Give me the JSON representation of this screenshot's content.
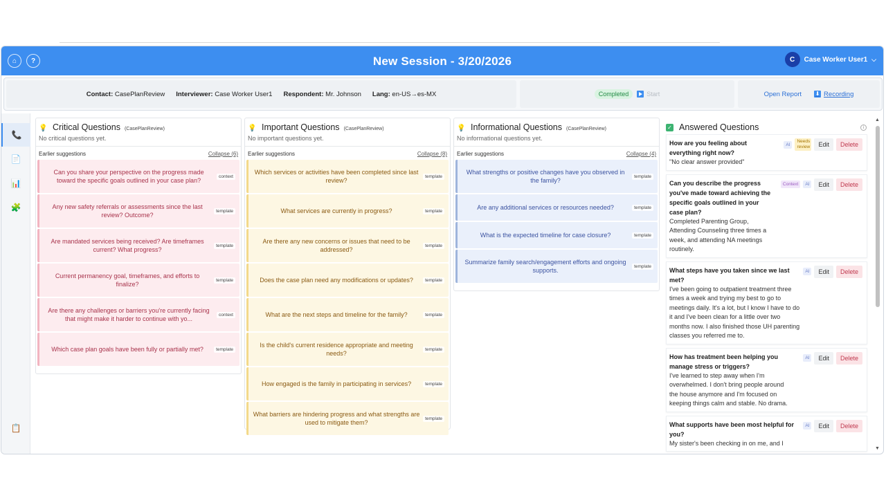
{
  "header": {
    "title": "New Session - 3/20/2026",
    "home_icon": "⌂",
    "help_icon": "?",
    "user_initial": "C",
    "user_name": "Case Worker User1",
    "chevron": "⌵"
  },
  "infobar": {
    "contact_label": "Contact:",
    "contact_value": "CasePlanReview",
    "interviewer_label": "Interviewer:",
    "interviewer_value": "Case Worker User1",
    "respondent_label": "Respondent:",
    "respondent_value": "Mr. Johnson",
    "lang_label": "Lang:",
    "lang_value": "en-US→es-MX",
    "status": "Completed",
    "start_label": "Start",
    "open_report": "Open Report",
    "recording": "Recording"
  },
  "sidebar": {
    "items": [
      {
        "icon": "phone-icon",
        "glyph": "📞"
      },
      {
        "icon": "document-icon",
        "glyph": "📄"
      },
      {
        "icon": "chart-icon",
        "glyph": "📊"
      },
      {
        "icon": "puzzle-icon",
        "glyph": "🧩"
      },
      {
        "icon": "clipboard-icon",
        "glyph": "📋"
      }
    ]
  },
  "columns": {
    "critical": {
      "title": "Critical Questions",
      "sub": "(CasePlanReview)",
      "empty": "No critical questions yet.",
      "earlier": "Earlier suggestions",
      "collapse": "Collapse (6)",
      "cards": [
        {
          "q": "Can you share your perspective on the progress made toward the specific goals outlined in your case plan?",
          "tag": "context"
        },
        {
          "q": "Any new safety referrals or assessments since the last review? Outcome?",
          "tag": "template"
        },
        {
          "q": "Are mandated services being received? Are timeframes current? What progress?",
          "tag": "template"
        },
        {
          "q": "Current permanency goal, timeframes, and efforts to finalize?",
          "tag": "template"
        },
        {
          "q": "Are there any challenges or barriers you're currently facing that might make it harder to continue with yo...",
          "tag": "context"
        },
        {
          "q": "Which case plan goals have been fully or partially met?",
          "tag": "template"
        }
      ]
    },
    "important": {
      "title": "Important Questions",
      "sub": "(CasePlanReview)",
      "empty": "No important questions yet.",
      "earlier": "Earlier suggestions",
      "collapse": "Collapse (8)",
      "cards": [
        {
          "q": "Which services or activities have been completed since last review?",
          "tag": "template"
        },
        {
          "q": "What services are currently in progress?",
          "tag": "template"
        },
        {
          "q": "Are there any new concerns or issues that need to be addressed?",
          "tag": "template"
        },
        {
          "q": "Does the case plan need any modifications or updates?",
          "tag": "template"
        },
        {
          "q": "What are the next steps and timeline for the family?",
          "tag": "template"
        },
        {
          "q": "Is the child's current residence appropriate and meeting needs?",
          "tag": "template"
        },
        {
          "q": "How engaged is the family in participating in services?",
          "tag": "template"
        },
        {
          "q": "What barriers are hindering progress and what strengths are used to mitigate them?",
          "tag": "template"
        }
      ]
    },
    "informational": {
      "title": "Informational Questions",
      "sub": "(CasePlanReview)",
      "empty": "No informational questions yet.",
      "earlier": "Earlier suggestions",
      "collapse": "Collapse (4)",
      "cards": [
        {
          "q": "What strengths or positive changes have you observed in the family?",
          "tag": "template"
        },
        {
          "q": "Are any additional services or resources needed?",
          "tag": "template"
        },
        {
          "q": "What is the expected timeline for case closure?",
          "tag": "template"
        },
        {
          "q": "Summarize family search/engagement efforts and ongoing supports.",
          "tag": "template"
        }
      ]
    }
  },
  "answered": {
    "title": "Answered Questions",
    "info_icon": "i",
    "edit": "Edit",
    "delete": "Delete",
    "ai": "AI",
    "context": "Context",
    "needs_review": "Needs review",
    "items": [
      {
        "q": "How are you feeling about everything right now?",
        "a": "\"No clear answer provided\""
      },
      {
        "q": "Can you describe the progress you've made toward achieving the specific goals outlined in your case plan?",
        "a": "Completed Parenting Group, Attending Counseling three times a week, and attending NA meetings routinely."
      },
      {
        "q": "What steps have you taken since we last met?",
        "a": "I've been going to outpatient treatment three times a week and trying my best to go to meetings daily. It's a lot, but I know I have to do it and I've been clean for a little over two months now. I also finished those UH parenting classes you referred me to."
      },
      {
        "q": "How has treatment been helping you manage stress or triggers?",
        "a": "I've learned to step away when I'm overwhelmed. I don't bring people around the house anymore and I'm focused on keeping things calm and stable. No drama."
      },
      {
        "q": "What supports have been most helpful for you?",
        "a": "My sister's been checking in on me, and I"
      }
    ]
  },
  "colors": {
    "accent": "#3d8ef0",
    "critical_bg": "#fdecef",
    "important_bg": "#fdf7e3",
    "informational_bg": "#eaf0fb"
  }
}
